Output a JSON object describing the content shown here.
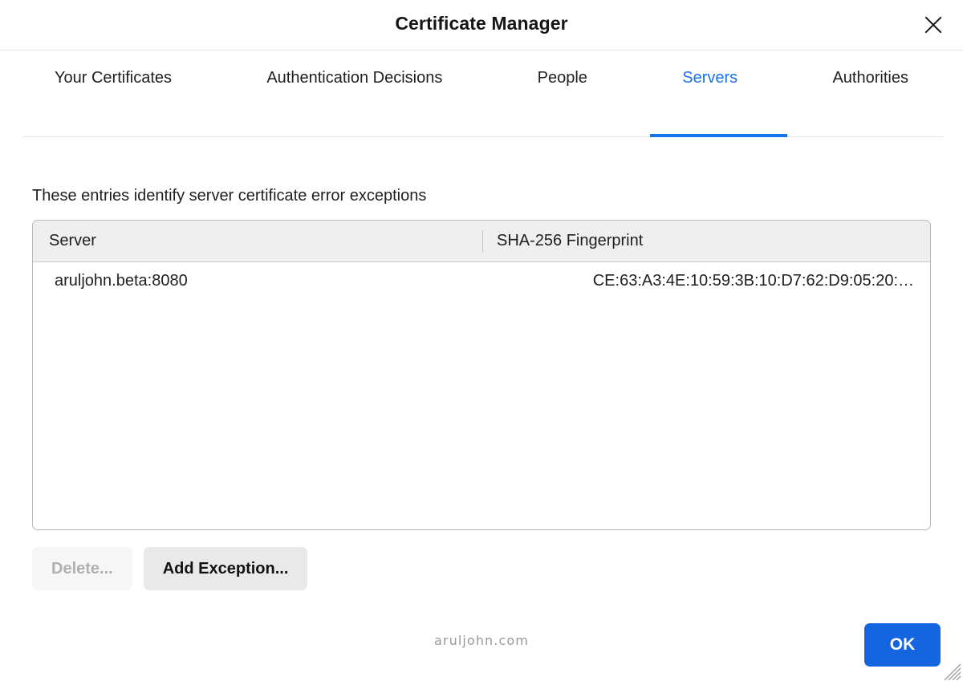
{
  "window": {
    "title": "Certificate Manager",
    "close_icon": "close-icon"
  },
  "tabs": [
    {
      "label": "Your Certificates",
      "active": false
    },
    {
      "label": "Authentication Decisions",
      "active": false
    },
    {
      "label": "People",
      "active": false
    },
    {
      "label": "Servers",
      "active": true
    },
    {
      "label": "Authorities",
      "active": false
    }
  ],
  "main": {
    "description": "These entries identify server certificate error exceptions",
    "table": {
      "columns": [
        "Server",
        "SHA-256 Fingerprint"
      ],
      "rows": [
        {
          "server": "aruljohn.beta:8080",
          "fingerprint": "CE:63:A3:4E:10:59:3B:10:D7:62:D9:05:20:…"
        }
      ]
    },
    "buttons": {
      "delete_label": "Delete...",
      "add_exception_label": "Add Exception..."
    }
  },
  "footer": {
    "watermark": "aruljohn.com",
    "ok_label": "OK"
  },
  "colors": {
    "accent": "#1a73e8",
    "ok_button": "#1565e0",
    "header_row": "#efefef",
    "disabled_text": "#b0b0b0"
  }
}
